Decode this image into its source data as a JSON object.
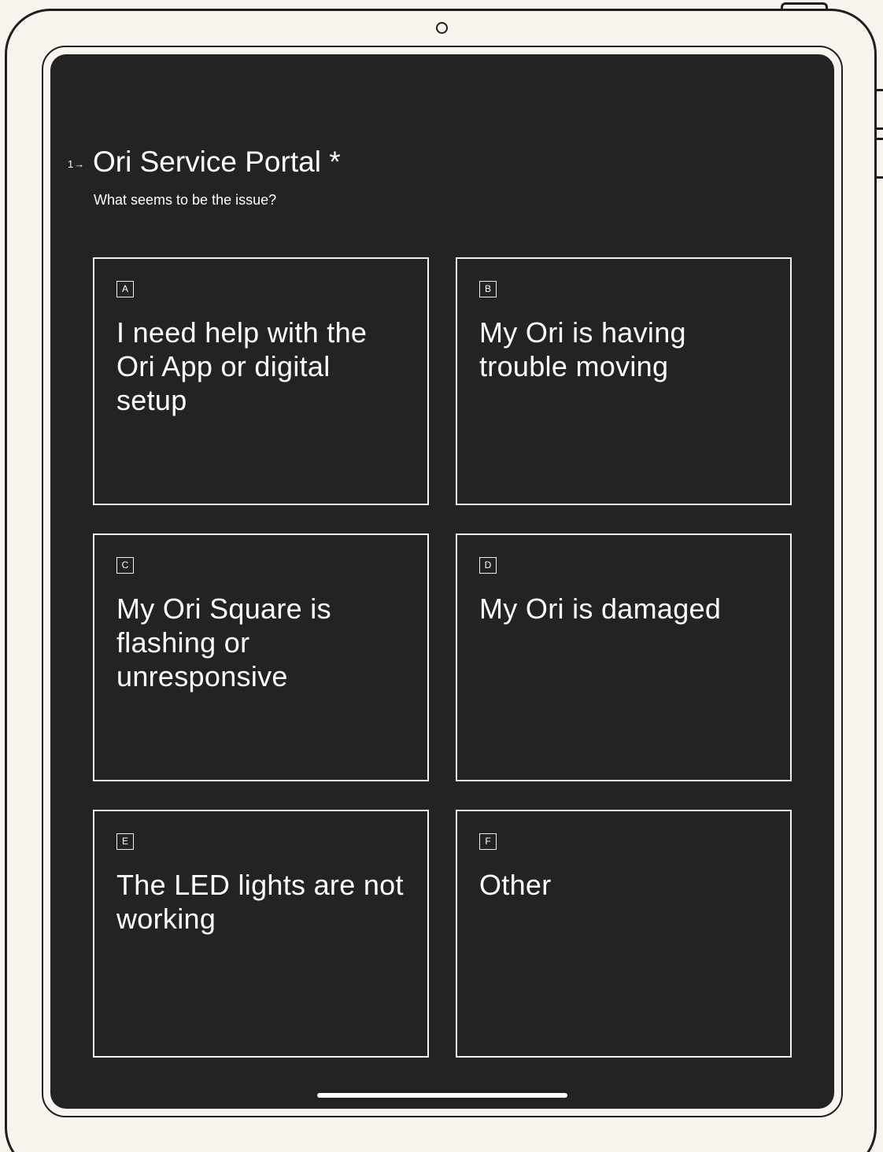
{
  "question": {
    "number": "1→",
    "title": "Ori Service Portal *",
    "subtitle": "What seems to be the issue?"
  },
  "options": [
    {
      "key": "A",
      "label": "I need help with the Ori App or digital setup"
    },
    {
      "key": "B",
      "label": "My Ori is having trouble moving"
    },
    {
      "key": "C",
      "label": "My Ori Square is flashing or unresponsive"
    },
    {
      "key": "D",
      "label": "My Ori is damaged"
    },
    {
      "key": "E",
      "label": "The LED lights are not working"
    },
    {
      "key": "F",
      "label": "Other"
    }
  ],
  "colors": {
    "screen_background": "#232323",
    "frame_background": "#f8f5ef",
    "text": "#ffffff",
    "option_border": "#f2f2f2"
  }
}
